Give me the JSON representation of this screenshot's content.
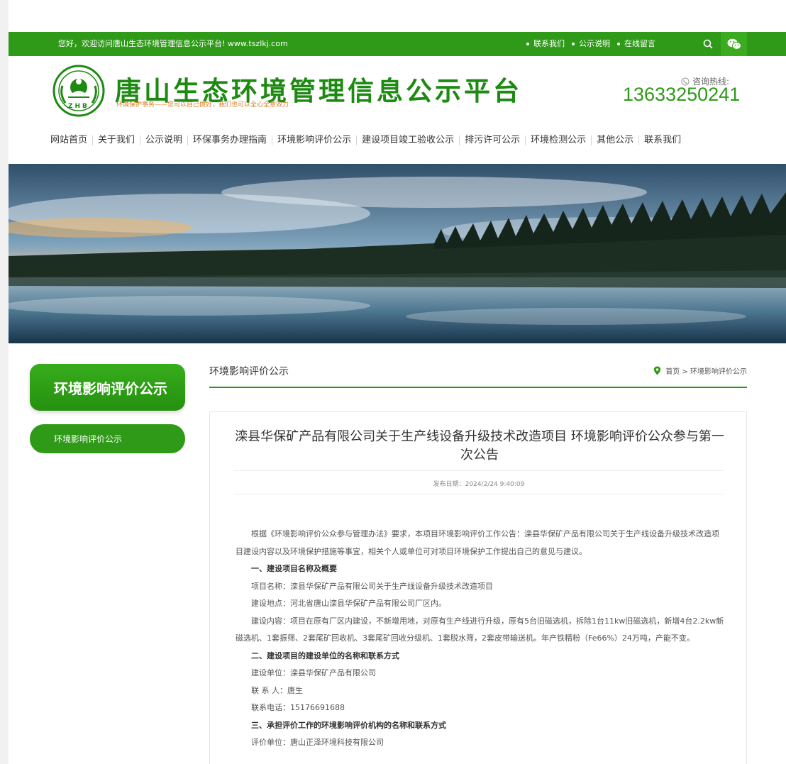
{
  "topbar": {
    "welcome": "您好，欢迎访问唐山生态环境管理信息公示平台! www.tszlkj.com",
    "links": [
      "联系我们",
      "公示说明",
      "在线留言"
    ]
  },
  "header": {
    "title": "唐山生态环境管理信息公示平台",
    "slogan": "环境保护事务——您可以自己做好，我们也可以全心全意效力",
    "logo_text": "ZHB",
    "hotline_label": "咨询热线:",
    "hotline_number": "13633250241"
  },
  "nav": [
    "网站首页",
    "关于我们",
    "公示说明",
    "环保事务办理指南",
    "环境影响评价公示",
    "建设项目竣工验收公示",
    "排污许可公示",
    "环境检测公示",
    "其他公示",
    "联系我们"
  ],
  "sidebar": {
    "title": "环境影响评价公示",
    "items": [
      "环境影响评价公示"
    ]
  },
  "content": {
    "section_title": "环境影响评价公示",
    "breadcrumb": "首页 > 环境影响评价公示"
  },
  "article": {
    "title": "滦县华保矿产品有限公司关于生产线设备升级技术改造项目 环境影响评价公众参与第一次公告",
    "date": "发布日期：2024/2/24 9:40:09",
    "paragraphs": [
      {
        "text": "根据《环境影响评价公众参与管理办法》要求，本项目环境影响评价工作公告：滦县华保矿产品有限公司关于生产线设备升级技术改造项目建设内容以及环境保护措施等事宜，相关个人或单位可对项目环境保护工作提出自己的意见与建议。",
        "bold": false
      },
      {
        "text": "一、建设项目名称及概要",
        "bold": true
      },
      {
        "text": "项目名称：滦县华保矿产品有限公司关于生产线设备升级技术改造项目",
        "bold": false
      },
      {
        "text": "建设地点：河北省唐山滦县华保矿产品有限公司厂区内。",
        "bold": false
      },
      {
        "text": "建设内容：项目在原有厂区内建设，不新增用地，对原有生产线进行升级，原有5台旧磁选机，拆除1台11kw旧磁选机，新增4台2.2kw新磁选机、1套振筛、2套尾矿回收机、3套尾矿回收分级机、1套脱水筛，2套皮带输送机。年产铁精粉（Fe66%）24万吨，产能不变。",
        "bold": false
      },
      {
        "text": "二、建设项目的建设单位的名称和联系方式",
        "bold": true
      },
      {
        "text": "建设单位：滦县华保矿产品有限公司",
        "bold": false
      },
      {
        "text": "联 系 人：唐生",
        "bold": false
      },
      {
        "text": "联系电话：15176691688",
        "bold": false
      },
      {
        "text": "三、承担评价工作的环境影响评价机构的名称和联系方式",
        "bold": true
      },
      {
        "text": "评价单位：唐山正泽环境科技有限公司",
        "bold": false
      }
    ]
  },
  "colors": {
    "brand_green": "#2e9a17",
    "hotline": "#2e9a17",
    "slogan": "#d77b1f"
  },
  "icons": [
    "search-icon",
    "wechat-icon",
    "phone-icon",
    "location-pin-icon"
  ]
}
